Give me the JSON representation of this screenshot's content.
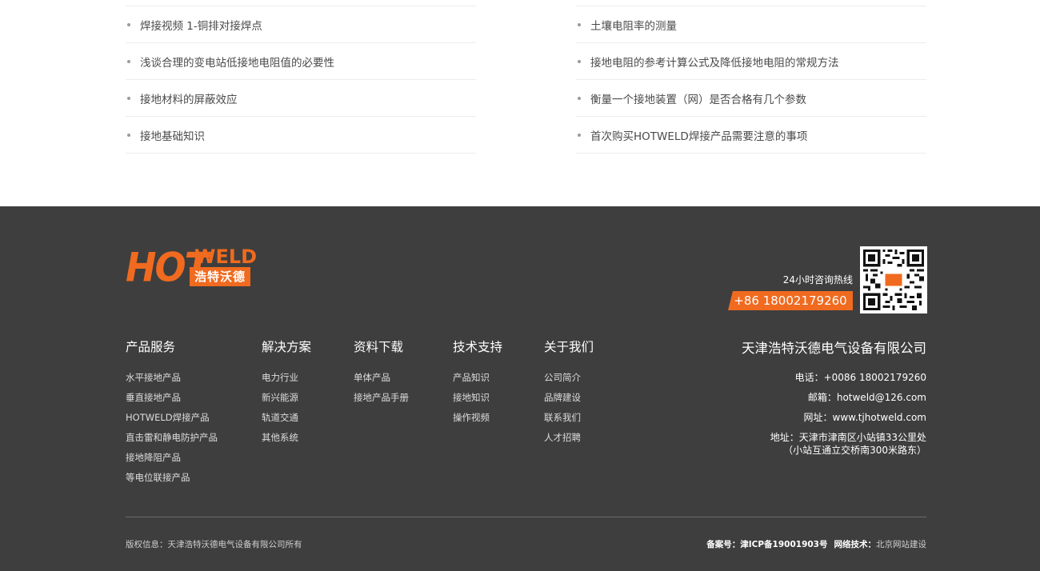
{
  "news": {
    "left": [
      "焊接视频 1-铜排对接焊点",
      "浅谈合理的变电站低接地电阻值的必要性",
      "接地材料的屏蔽效应",
      "接地基础知识"
    ],
    "right": [
      "土壤电阻率的测量",
      "接地电阻的参考计算公式及降低接地电阻的常规方法",
      "衡量一个接地装置（网）是否合格有几个参数",
      "首次购买HOTWELD焊接产品需要注意的事项"
    ]
  },
  "logo": {
    "hot": "HOT",
    "weld": "WELD",
    "cn": "浩特沃德"
  },
  "hotline": {
    "label": "24小时咨询热线",
    "phone": "+86 18002179260"
  },
  "nav": [
    {
      "heading": "产品服务",
      "links": [
        "水平接地产品",
        "垂直接地产品",
        "HOTWELD焊接产品",
        "直击雷和静电防护产品",
        "接地降阻产品",
        "等电位联接产品"
      ]
    },
    {
      "heading": "解决方案",
      "links": [
        "电力行业",
        "新兴能源",
        "轨道交通",
        "其他系统"
      ]
    },
    {
      "heading": "资料下载",
      "links": [
        "单体产品",
        "接地产品手册"
      ]
    },
    {
      "heading": "技术支持",
      "links": [
        "产品知识",
        "接地知识",
        "操作视频"
      ]
    },
    {
      "heading": "关于我们",
      "links": [
        "公司简介",
        "品牌建设",
        "联系我们",
        "人才招聘"
      ]
    }
  ],
  "company": {
    "name": "天津浩特沃德电气设备有限公司",
    "phone": "电话：+0086 18002179260",
    "email": "邮箱：hotweld@126.com",
    "website": "网址：www.tjhotweld.com",
    "address1": "地址：天津市津南区小站镇33公里处",
    "address2": "（小站互通立交桥南300米路东）"
  },
  "bottom": {
    "copyright": "版权信息：天津浩特沃德电气设备有限公司所有",
    "icp_label": "备案号：",
    "icp": "津ICP备19001903号",
    "tech_label": "网络技术：",
    "tech": "北京网站建设"
  },
  "colors": {
    "accent": "#f06a1f",
    "footer_bg": "#3e3e3e"
  }
}
